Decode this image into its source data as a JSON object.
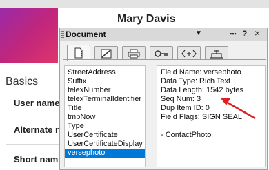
{
  "top_fragment": "",
  "contact": {
    "name": "Mary Davis"
  },
  "left": {
    "section": "Basics",
    "fields": [
      "User name",
      "Alternate n",
      "Short nam"
    ]
  },
  "properties": {
    "title": "Document",
    "toolbar": {
      "help": "?",
      "close": "×"
    },
    "tabs": [
      "Info",
      "Fields",
      "Printing",
      "Security",
      "HTML tags",
      "Design"
    ],
    "field_list": [
      "StreetAddress",
      "Suffix",
      "telexNumber",
      "telexTerminalIdentifier",
      "Title",
      "tmpNow",
      "Type",
      "UserCertificate",
      "UserCertificateDisplay",
      "versephoto"
    ],
    "selected_field": "versephoto",
    "field_info": [
      "Field Name: versephoto",
      "Data Type: Rich Text",
      "Data Length: 1542 bytes",
      "Seq Num: 3",
      "Dup Item ID: 0",
      "Field Flags: SIGN SEAL",
      "",
      "- ContactPhoto"
    ]
  },
  "colors": {
    "selection": "#0078d7",
    "annotation_arrow": "#e02020"
  }
}
